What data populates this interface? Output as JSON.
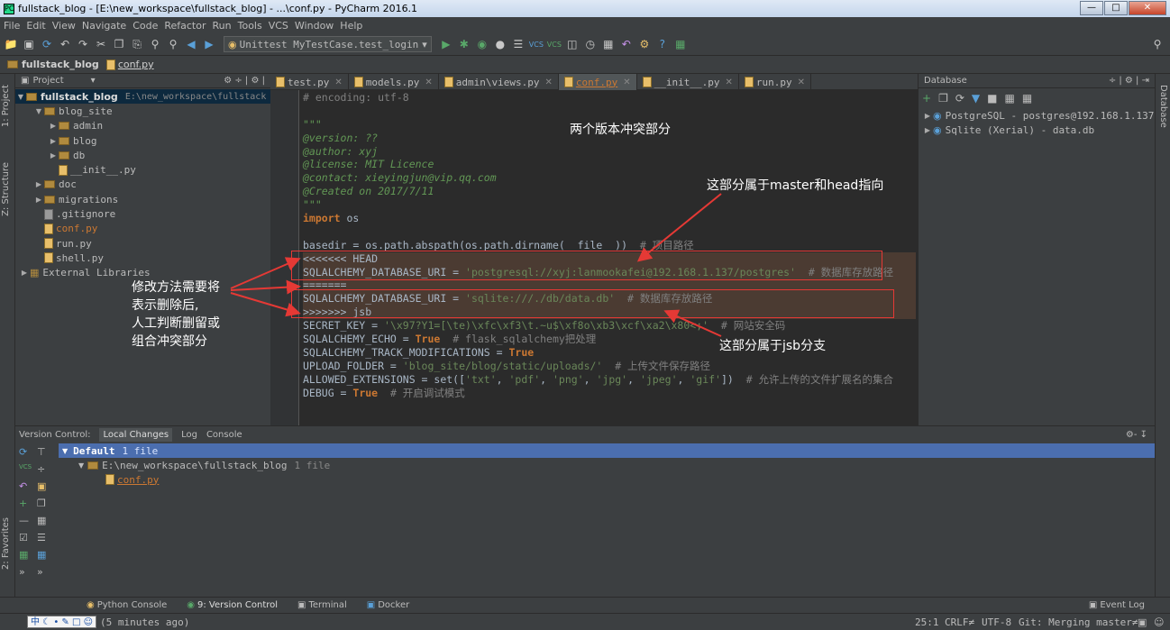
{
  "window": {
    "title": "fullstack_blog - [E:\\new_workspace\\fullstack_blog] - ...\\conf.py - PyCharm 2016.1"
  },
  "menu": [
    "File",
    "Edit",
    "View",
    "Navigate",
    "Code",
    "Refactor",
    "Run",
    "Tools",
    "VCS",
    "Window",
    "Help"
  ],
  "toolbar": {
    "run_config": "Unittest MyTestCase.test_login"
  },
  "breadcrumb": {
    "project": "fullstack_blog",
    "file": "conf.py"
  },
  "project_panel": {
    "header": "Project",
    "root": "fullstack_blog",
    "root_path": "E:\\new_workspace\\fullstack",
    "items": [
      {
        "label": "blog_site",
        "depth": 1,
        "type": "folder",
        "expanded": true
      },
      {
        "label": "admin",
        "depth": 2,
        "type": "folder"
      },
      {
        "label": "blog",
        "depth": 2,
        "type": "folder"
      },
      {
        "label": "db",
        "depth": 2,
        "type": "folder"
      },
      {
        "label": "__init__.py",
        "depth": 2,
        "type": "py"
      },
      {
        "label": "doc",
        "depth": 1,
        "type": "folder"
      },
      {
        "label": "migrations",
        "depth": 1,
        "type": "folder"
      },
      {
        "label": ".gitignore",
        "depth": 1,
        "type": "file"
      },
      {
        "label": "conf.py",
        "depth": 1,
        "type": "py",
        "modified": true
      },
      {
        "label": "run.py",
        "depth": 1,
        "type": "py"
      },
      {
        "label": "shell.py",
        "depth": 1,
        "type": "py"
      }
    ],
    "external": "External Libraries"
  },
  "left_strip": {
    "project": "1: Project",
    "structure": "Z: Structure",
    "favorites": "2: Favorites"
  },
  "right_strip": {
    "database": "Database"
  },
  "editor_tabs": [
    {
      "label": "test.py",
      "active": false
    },
    {
      "label": "models.py",
      "active": false
    },
    {
      "label": "admin\\views.py",
      "active": false
    },
    {
      "label": "conf.py",
      "active": true
    },
    {
      "label": "__init__.py",
      "active": false
    },
    {
      "label": "run.py",
      "active": false
    }
  ],
  "code": [
    "# encoding: utf-8",
    "",
    "\"\"\"",
    "@version: ??",
    "@author: xyj",
    "@license: MIT Licence",
    "@contact: xieyingjun@vip.qq.com",
    "@Created on 2017/7/11",
    "\"\"\"",
    "import os",
    "",
    "basedir = os.path.abspath(os.path.dirname(__file__))  # 项目路径",
    "<<<<<<< HEAD",
    "SQLALCHEMY_DATABASE_URI = 'postgresql://xyj:lanmookafei@192.168.1.137/postgres'  # 数据库存放路径",
    "=======",
    "SQLALCHEMY_DATABASE_URI = 'sqlite:///./db/data.db'  # 数据库存放路径",
    ">>>>>>> jsb",
    "SECRET_KEY = '\\x97?Y1=[\\te)\\xfc\\xf3\\t.~u$\\xf8o\\xb3\\xcf\\xa2\\x80<;'  # 网站安全码",
    "SQLALCHEMY_ECHO = True  # flask_sqlalchemy把处理",
    "SQLALCHEMY_TRACK_MODIFICATIONS = True",
    "UPLOAD_FOLDER = 'blog_site/blog/static/uploads/'  # 上传文件保存路径",
    "ALLOWED_EXTENSIONS = set(['txt', 'pdf', 'png', 'jpg', 'jpeg', 'gif'])  # 允许上传的文件扩展名的集合",
    "DEBUG = True  # 开启调试模式"
  ],
  "annotations": {
    "conflict_title": "两个版本冲突部分",
    "master_head": "这部分属于master和head指向",
    "jsb_branch": "这部分属于jsb分支",
    "fix_method": [
      "修改方法需要将",
      "表示删除后,",
      "人工判断删留或",
      "组合冲突部分"
    ]
  },
  "database_panel": {
    "header": "Database",
    "items": [
      "PostgreSQL - postgres@192.168.1.137",
      "Sqlite (Xerial) - data.db"
    ]
  },
  "vcs_panel": {
    "tabs": [
      "Version Control:",
      "Local Changes",
      "Log",
      "Console"
    ],
    "changelist": "Default",
    "changelist_count": "1 file",
    "path": "E:\\new_workspace\\fullstack_blog",
    "path_count": "1 file",
    "file": "conf.py"
  },
  "bottom_tabs": [
    "Python Console",
    "9: Version Control",
    "Terminal",
    "Docker"
  ],
  "event_log": "Event Log",
  "status": {
    "message": "(5 minutes ago)",
    "position": "25:1",
    "line_sep": "CRLF≠",
    "encoding": "UTF-8",
    "git": "Git: Merging master≠"
  },
  "colors": {
    "conflict_box": "#e53935",
    "accent": "#cc7832",
    "string": "#6a8759"
  }
}
